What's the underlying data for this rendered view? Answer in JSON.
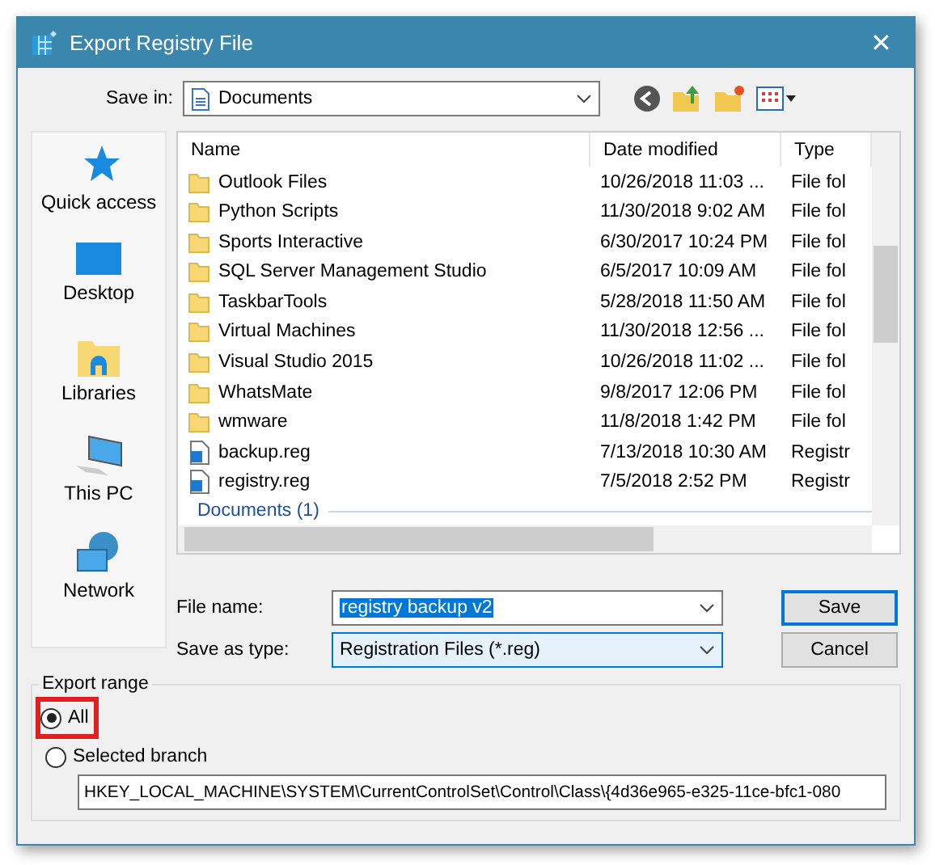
{
  "window": {
    "title": "Export Registry File",
    "close": "✕"
  },
  "save_in": {
    "label": "Save in:",
    "value": "Documents"
  },
  "places": [
    {
      "label": "Quick access",
      "kind": "star"
    },
    {
      "label": "Desktop",
      "kind": "desktop"
    },
    {
      "label": "Libraries",
      "kind": "libraries"
    },
    {
      "label": "This PC",
      "kind": "pc"
    },
    {
      "label": "Network",
      "kind": "network"
    }
  ],
  "table": {
    "columns": [
      "Name",
      "Date modified",
      "Type"
    ],
    "rows": [
      {
        "kind": "folder",
        "name": "Outlook Files",
        "date": "10/26/2018 11:03 ...",
        "type": "File fol"
      },
      {
        "kind": "folder",
        "name": "Python Scripts",
        "date": "11/30/2018 9:02 AM",
        "type": "File fol"
      },
      {
        "kind": "folder",
        "name": "Sports Interactive",
        "date": "6/30/2017 10:24 PM",
        "type": "File fol"
      },
      {
        "kind": "folder",
        "name": "SQL Server Management Studio",
        "date": "6/5/2017 10:09 AM",
        "type": "File fol"
      },
      {
        "kind": "folder",
        "name": "TaskbarTools",
        "date": "5/28/2018 11:50 AM",
        "type": "File fol"
      },
      {
        "kind": "folder",
        "name": "Virtual Machines",
        "date": "11/30/2018 12:56 ...",
        "type": "File fol"
      },
      {
        "kind": "folder",
        "name": "Visual Studio 2015",
        "date": "10/26/2018 11:02 ...",
        "type": "File fol"
      },
      {
        "kind": "folder",
        "name": "WhatsMate",
        "date": "9/8/2017 12:06 PM",
        "type": "File fol"
      },
      {
        "kind": "folder",
        "name": "wmware",
        "date": "11/8/2018 1:42 PM",
        "type": "File fol"
      },
      {
        "kind": "reg",
        "name": "backup.reg",
        "date": "7/13/2018 10:30 AM",
        "type": "Registr"
      },
      {
        "kind": "reg",
        "name": "registry.reg",
        "date": "7/5/2018 2:52 PM",
        "type": "Registr"
      }
    ],
    "group_header": "Documents (1)"
  },
  "file_name": {
    "label": "File name:",
    "value": "registry backup v2"
  },
  "save_as_type": {
    "label": "Save as type:",
    "value": "Registration Files (*.reg)"
  },
  "buttons": [
    "Save",
    "Cancel"
  ],
  "export_range": {
    "title": "Export range",
    "options": [
      {
        "label": "All",
        "selected": true
      },
      {
        "label": "Selected branch",
        "selected": false
      }
    ],
    "branch": "HKEY_LOCAL_MACHINE\\SYSTEM\\CurrentControlSet\\Control\\Class\\{4d36e965-e325-11ce-bfc1-080"
  }
}
